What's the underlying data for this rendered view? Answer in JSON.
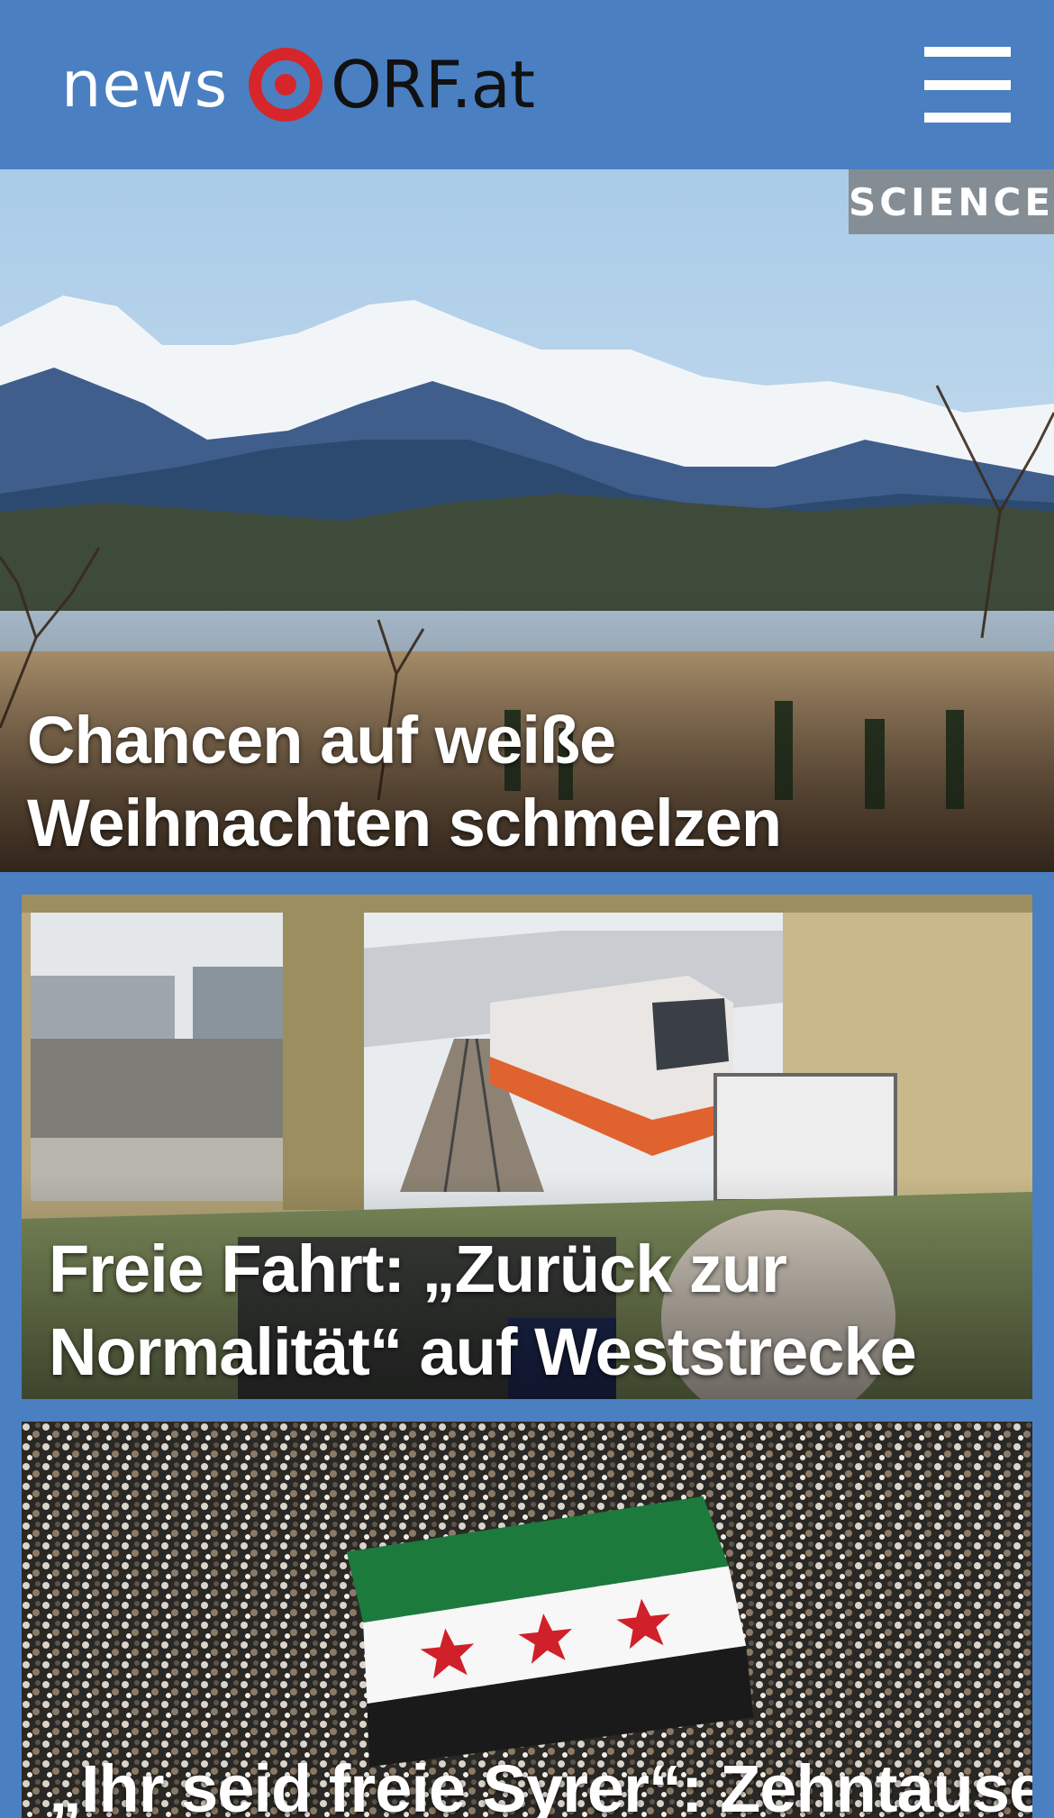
{
  "header": {
    "logo_news": "news",
    "logo_orf": "ORF.at",
    "brand_color": "#4a7fc2",
    "logo_eye_color": "#d7262b"
  },
  "articles": [
    {
      "category": "SCIENCE",
      "headline": "Chancen auf weiße Weihnachten schmelzen"
    },
    {
      "headline": "Freie Fahrt: „Zurück zur Normalität“ auf Weststrecke"
    },
    {
      "headline": "„Ihr seid freie Syrer“: Zehntausende"
    }
  ]
}
